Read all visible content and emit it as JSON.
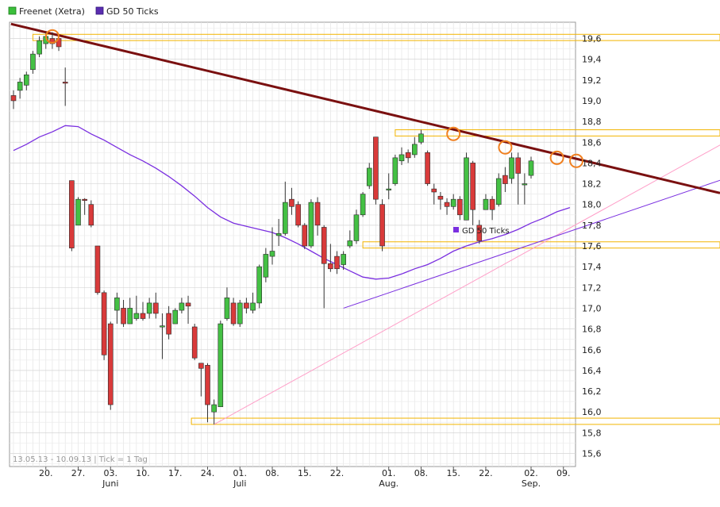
{
  "legend": [
    {
      "label": "Freenet (Xetra)",
      "color": "#3bbf3b"
    },
    {
      "label": "GD 50 Ticks",
      "color": "#5a2db0"
    }
  ],
  "footer": "13.05.13 - 10.09.13  | Tick = 1 Tag",
  "overlay_label": "GD 50 Ticks",
  "colors": {
    "up": "#44c044",
    "down": "#d93a3a",
    "ma": "#7a2fe0",
    "trend_main": "#7a1010",
    "support_lines": "#ff9ec8",
    "zones": "#f2b400",
    "markers": "#f08020"
  },
  "chart_data": {
    "type": "candlestick",
    "title": "",
    "ylim": [
      15.5,
      19.8
    ],
    "y_ticks": [
      "19,6",
      "19,4",
      "19,2",
      "19,0",
      "18,8",
      "18,6",
      "18,4",
      "18,2",
      "18,0",
      "17,8",
      "17,6",
      "17,4",
      "17,2",
      "17,0",
      "16,8",
      "16,6",
      "16,4",
      "16,2",
      "16,0",
      "15,8",
      "15,6"
    ],
    "y_tick_values": [
      19.6,
      19.4,
      19.2,
      19.0,
      18.8,
      18.6,
      18.4,
      18.2,
      18.0,
      17.8,
      17.6,
      17.4,
      17.2,
      17.0,
      16.8,
      16.6,
      16.4,
      16.2,
      16.0,
      15.8,
      15.6
    ],
    "x_day_labels": [
      {
        "label": "20.",
        "i": 5
      },
      {
        "label": "27.",
        "i": 10
      },
      {
        "label": "03.",
        "i": 15
      },
      {
        "label": "10.",
        "i": 20
      },
      {
        "label": "17.",
        "i": 25
      },
      {
        "label": "24.",
        "i": 30
      },
      {
        "label": "01.",
        "i": 35
      },
      {
        "label": "08.",
        "i": 40
      },
      {
        "label": "15.",
        "i": 45
      },
      {
        "label": "22.",
        "i": 50
      },
      {
        "label": "01.",
        "i": 58
      },
      {
        "label": "08.",
        "i": 63
      },
      {
        "label": "15.",
        "i": 68
      },
      {
        "label": "22.",
        "i": 73
      },
      {
        "label": "02.",
        "i": 80
      },
      {
        "label": "09.",
        "i": 85
      }
    ],
    "x_month_labels": [
      {
        "label": "Juni",
        "i": 15
      },
      {
        "label": "Juli",
        "i": 35
      },
      {
        "label": "Aug.",
        "i": 58
      },
      {
        "label": "Sep.",
        "i": 80
      }
    ],
    "candles": [
      [
        19.05,
        19.0,
        19.1,
        18.92
      ],
      [
        19.1,
        19.18,
        19.22,
        19.02
      ],
      [
        19.15,
        19.25,
        19.28,
        19.1
      ],
      [
        19.3,
        19.45,
        19.48,
        19.26
      ],
      [
        19.45,
        19.58,
        19.62,
        19.42
      ],
      [
        19.55,
        19.62,
        19.66,
        19.5
      ],
      [
        19.6,
        19.55,
        19.66,
        19.5
      ],
      [
        19.6,
        19.52,
        19.62,
        19.48
      ],
      [
        19.18,
        19.17,
        19.32,
        18.95
      ],
      [
        18.23,
        17.58,
        18.23,
        17.55
      ],
      [
        17.8,
        18.05,
        18.07,
        17.8
      ],
      [
        18.05,
        18.04,
        18.06,
        17.9
      ],
      [
        18.0,
        17.8,
        18.04,
        17.78
      ],
      [
        17.6,
        17.15,
        17.6,
        17.13
      ],
      [
        17.15,
        16.55,
        17.17,
        16.5
      ],
      [
        16.85,
        16.07,
        16.87,
        16.02
      ],
      [
        16.98,
        17.1,
        17.15,
        16.85
      ],
      [
        17.0,
        16.85,
        17.08,
        16.82
      ],
      [
        16.85,
        17.0,
        17.1,
        16.85
      ],
      [
        16.9,
        16.95,
        17.12,
        16.88
      ],
      [
        16.95,
        16.9,
        17.06,
        16.88
      ],
      [
        16.95,
        17.05,
        17.1,
        16.9
      ],
      [
        17.05,
        16.95,
        17.15,
        16.9
      ],
      [
        16.82,
        16.83,
        16.95,
        16.51
      ],
      [
        16.95,
        16.75,
        17.02,
        16.7
      ],
      [
        16.85,
        16.98,
        17.0,
        16.85
      ],
      [
        16.98,
        17.05,
        17.1,
        16.95
      ],
      [
        17.05,
        17.02,
        17.12,
        16.85
      ],
      [
        16.82,
        16.52,
        16.85,
        16.5
      ],
      [
        16.47,
        16.42,
        16.47,
        16.15
      ],
      [
        16.45,
        16.07,
        16.47,
        15.9
      ],
      [
        16.0,
        16.07,
        16.12,
        15.88
      ],
      [
        16.05,
        16.85,
        16.88,
        16.05
      ],
      [
        16.9,
        17.1,
        17.2,
        16.88
      ],
      [
        17.05,
        16.85,
        17.1,
        16.83
      ],
      [
        16.85,
        17.05,
        17.08,
        16.82
      ],
      [
        17.05,
        17.0,
        17.1,
        16.95
      ],
      [
        16.98,
        17.05,
        17.15,
        16.95
      ],
      [
        17.05,
        17.4,
        17.42,
        17.0
      ],
      [
        17.3,
        17.52,
        17.58,
        17.25
      ],
      [
        17.5,
        17.55,
        17.78,
        17.42
      ],
      [
        17.7,
        17.72,
        17.86,
        17.6
      ],
      [
        17.72,
        18.02,
        18.22,
        17.7
      ],
      [
        18.05,
        17.98,
        18.16,
        17.9
      ],
      [
        18.0,
        17.8,
        18.03,
        17.78
      ],
      [
        17.8,
        17.6,
        17.82,
        17.57
      ],
      [
        17.6,
        18.02,
        18.05,
        17.58
      ],
      [
        18.02,
        17.8,
        18.07,
        17.7
      ],
      [
        17.78,
        17.43,
        17.8,
        17.0
      ],
      [
        17.43,
        17.38,
        17.62,
        17.35
      ],
      [
        17.5,
        17.38,
        17.55,
        17.33
      ],
      [
        17.42,
        17.52,
        17.55,
        17.37
      ],
      [
        17.6,
        17.65,
        17.75,
        17.58
      ],
      [
        17.65,
        17.9,
        17.95,
        17.62
      ],
      [
        17.9,
        18.1,
        18.12,
        17.88
      ],
      [
        18.18,
        18.35,
        18.4,
        18.15
      ],
      [
        18.65,
        18.05,
        18.65,
        18.0
      ],
      [
        18.0,
        17.6,
        18.05,
        17.55
      ],
      [
        18.15,
        18.15,
        18.3,
        18.05
      ],
      [
        18.2,
        18.45,
        18.48,
        18.18
      ],
      [
        18.42,
        18.48,
        18.55,
        18.38
      ],
      [
        18.5,
        18.45,
        18.53,
        18.4
      ],
      [
        18.48,
        18.58,
        18.65,
        18.45
      ],
      [
        18.6,
        18.68,
        18.72,
        18.58
      ],
      [
        18.5,
        18.2,
        18.52,
        18.18
      ],
      [
        18.15,
        18.12,
        18.2,
        18.0
      ],
      [
        18.08,
        18.05,
        18.12,
        17.95
      ],
      [
        18.02,
        17.98,
        18.06,
        17.9
      ],
      [
        17.98,
        18.05,
        18.1,
        17.95
      ],
      [
        18.05,
        17.9,
        18.08,
        17.85
      ],
      [
        17.85,
        18.45,
        18.5,
        17.85
      ],
      [
        18.4,
        17.95,
        18.42,
        17.8
      ],
      [
        17.8,
        17.65,
        17.85,
        17.62
      ],
      [
        17.95,
        18.05,
        18.1,
        17.95
      ],
      [
        18.05,
        17.95,
        18.08,
        17.85
      ],
      [
        18.0,
        18.25,
        18.3,
        17.98
      ],
      [
        18.28,
        18.2,
        18.36,
        18.12
      ],
      [
        18.25,
        18.45,
        18.5,
        18.2
      ],
      [
        18.45,
        18.3,
        18.5,
        18.0
      ],
      [
        18.2,
        18.2,
        18.3,
        18.0
      ],
      [
        18.28,
        18.42,
        18.46,
        18.25
      ]
    ],
    "ma": [
      [
        0,
        18.52
      ],
      [
        2,
        18.58
      ],
      [
        4,
        18.65
      ],
      [
        6,
        18.7
      ],
      [
        8,
        18.76
      ],
      [
        10,
        18.75
      ],
      [
        12,
        18.68
      ],
      [
        14,
        18.62
      ],
      [
        16,
        18.55
      ],
      [
        18,
        18.48
      ],
      [
        20,
        18.42
      ],
      [
        22,
        18.35
      ],
      [
        24,
        18.27
      ],
      [
        26,
        18.18
      ],
      [
        28,
        18.08
      ],
      [
        30,
        17.97
      ],
      [
        32,
        17.88
      ],
      [
        34,
        17.82
      ],
      [
        36,
        17.79
      ],
      [
        38,
        17.76
      ],
      [
        40,
        17.73
      ],
      [
        42,
        17.68
      ],
      [
        44,
        17.62
      ],
      [
        46,
        17.55
      ],
      [
        48,
        17.48
      ],
      [
        50,
        17.42
      ],
      [
        52,
        17.36
      ],
      [
        54,
        17.3
      ],
      [
        56,
        17.28
      ],
      [
        58,
        17.29
      ],
      [
        60,
        17.33
      ],
      [
        62,
        17.38
      ],
      [
        64,
        17.42
      ],
      [
        66,
        17.48
      ],
      [
        68,
        17.55
      ],
      [
        70,
        17.6
      ],
      [
        72,
        17.64
      ],
      [
        74,
        17.67
      ],
      [
        76,
        17.71
      ],
      [
        78,
        17.76
      ],
      [
        80,
        17.82
      ],
      [
        82,
        17.87
      ],
      [
        84,
        17.93
      ],
      [
        86,
        17.97
      ]
    ],
    "zones": [
      {
        "y0": 19.58,
        "y1": 19.64,
        "i0": 3,
        "i1": 999
      },
      {
        "y0": 18.66,
        "y1": 18.72,
        "i0": 59,
        "i1": 999
      },
      {
        "y0": 17.58,
        "y1": 17.64,
        "i0": 54,
        "i1": 999
      },
      {
        "y0": 15.88,
        "y1": 15.94,
        "i0": 27.5,
        "i1": 999
      }
    ],
    "trend_main": [
      [
        -1,
        19.74
      ],
      [
        110,
        18.11
      ]
    ],
    "trend_lines": [
      {
        "pts": [
          [
            31,
            15.88
          ],
          [
            110,
            18.6
          ]
        ],
        "kind": "pink"
      },
      {
        "pts": [
          [
            51,
            17.0
          ],
          [
            110,
            18.25
          ]
        ],
        "kind": "purple"
      }
    ],
    "markers": [
      [
        6,
        19.62
      ],
      [
        68,
        18.68
      ],
      [
        76,
        18.55
      ],
      [
        84,
        18.45
      ],
      [
        87,
        18.42
      ]
    ]
  }
}
